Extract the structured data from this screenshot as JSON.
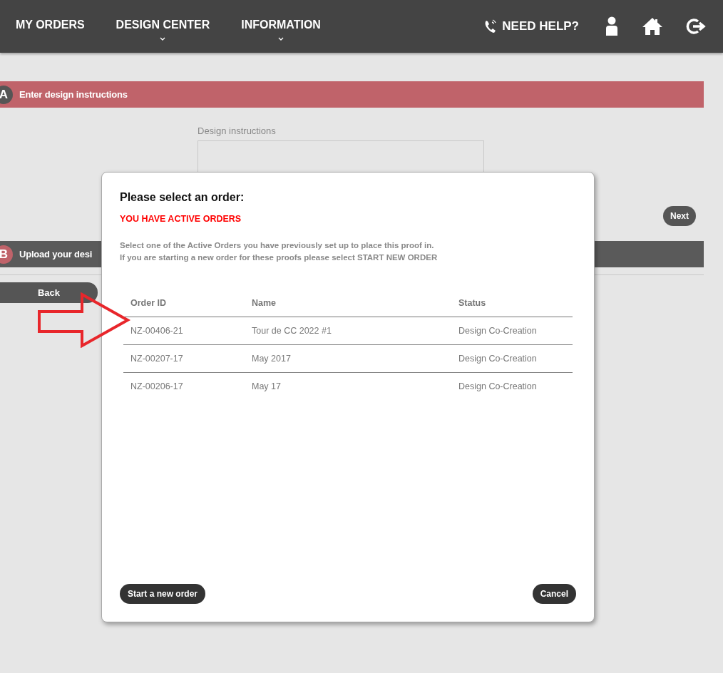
{
  "nav": {
    "items": [
      {
        "label": "MY ORDERS",
        "dropdown": false
      },
      {
        "label": "DESIGN CENTER",
        "dropdown": true
      },
      {
        "label": "INFORMATION",
        "dropdown": true
      }
    ],
    "help": "NEED HELP?"
  },
  "sections": [
    {
      "letter": "A",
      "title": "Enter design instructions",
      "active": true
    },
    {
      "letter": "B",
      "title": "Upload your desi",
      "active": false
    }
  ],
  "design_field": {
    "label": "Design instructions"
  },
  "next_button": "Next",
  "back_button": "Back",
  "dialog": {
    "title": "Please select an order:",
    "alert": "YOU HAVE ACTIVE ORDERS",
    "instructions": [
      "Select one of the Active Orders you have previously set up to place this proof in.",
      "If you are starting a new order for these proofs please select START NEW ORDER"
    ],
    "columns": [
      "Order ID",
      "Name",
      "Status"
    ],
    "rows": [
      [
        "NZ-00406-21",
        "Tour de CC 2022 #1",
        "Design Co-Creation"
      ],
      [
        "NZ-00207-17",
        "May 2017",
        "Design Co-Creation"
      ],
      [
        "NZ-00206-17",
        "May 17",
        "Design Co-Creation"
      ]
    ],
    "buttons": [
      "Start a new order",
      "Cancel"
    ]
  }
}
